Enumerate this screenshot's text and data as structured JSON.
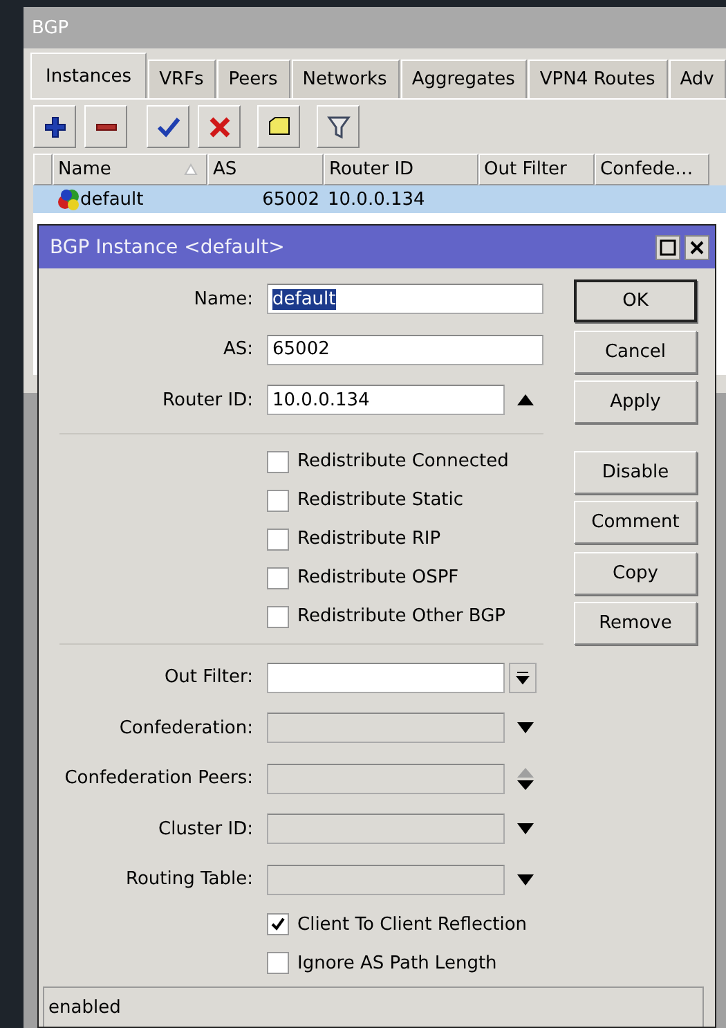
{
  "window": {
    "title": "BGP"
  },
  "tabs": [
    {
      "label": "Instances",
      "selected": true
    },
    {
      "label": "VRFs",
      "selected": false
    },
    {
      "label": "Peers",
      "selected": false
    },
    {
      "label": "Networks",
      "selected": false
    },
    {
      "label": "Aggregates",
      "selected": false
    },
    {
      "label": "VPN4 Routes",
      "selected": false
    },
    {
      "label": "Adv",
      "selected": false
    }
  ],
  "table": {
    "columns": [
      {
        "label": "Name",
        "sorted": true
      },
      {
        "label": "AS",
        "sorted": false
      },
      {
        "label": "Router ID",
        "sorted": false
      },
      {
        "label": "Out Filter",
        "sorted": false
      },
      {
        "label": "Confede…",
        "sorted": false
      }
    ],
    "rows": [
      {
        "cells": [
          "default",
          "65002",
          "10.0.0.134"
        ],
        "selected": true
      }
    ]
  },
  "dialog": {
    "title": "BGP Instance <default>",
    "top_fields": [
      {
        "label": "Name:",
        "value": "default",
        "kind": "text",
        "highlighted": true
      },
      {
        "label": "AS:",
        "value": "65002",
        "kind": "text",
        "highlighted": false
      },
      {
        "label": "Router ID:",
        "value": "10.0.0.134",
        "kind": "collapse",
        "highlighted": false
      }
    ],
    "redistribute": [
      {
        "label": "Redistribute Connected",
        "checked": false
      },
      {
        "label": "Redistribute Static",
        "checked": false
      },
      {
        "label": "Redistribute RIP",
        "checked": false
      },
      {
        "label": "Redistribute OSPF",
        "checked": false
      },
      {
        "label": "Redistribute Other BGP",
        "checked": false
      }
    ],
    "bottom_fields": [
      {
        "label": "Out Filter:",
        "kind": "dropdown-button",
        "disabled": false
      },
      {
        "label": "Confederation:",
        "kind": "dropdown",
        "disabled": true
      },
      {
        "label": "Confederation Peers:",
        "kind": "updown",
        "disabled": true
      },
      {
        "label": "Cluster ID:",
        "kind": "dropdown",
        "disabled": true
      },
      {
        "label": "Routing Table:",
        "kind": "dropdown",
        "disabled": true
      }
    ],
    "options": [
      {
        "label": "Client To Client Reflection",
        "checked": true
      },
      {
        "label": "Ignore AS Path Length",
        "checked": false
      }
    ],
    "button_groups": [
      [
        {
          "label": "OK",
          "default": true
        },
        {
          "label": "Cancel",
          "default": false
        },
        {
          "label": "Apply",
          "default": false
        }
      ],
      [
        {
          "label": "Disable",
          "default": false
        },
        {
          "label": "Comment",
          "default": false
        },
        {
          "label": "Copy",
          "default": false
        },
        {
          "label": "Remove",
          "default": false
        }
      ]
    ],
    "status": "enabled"
  }
}
